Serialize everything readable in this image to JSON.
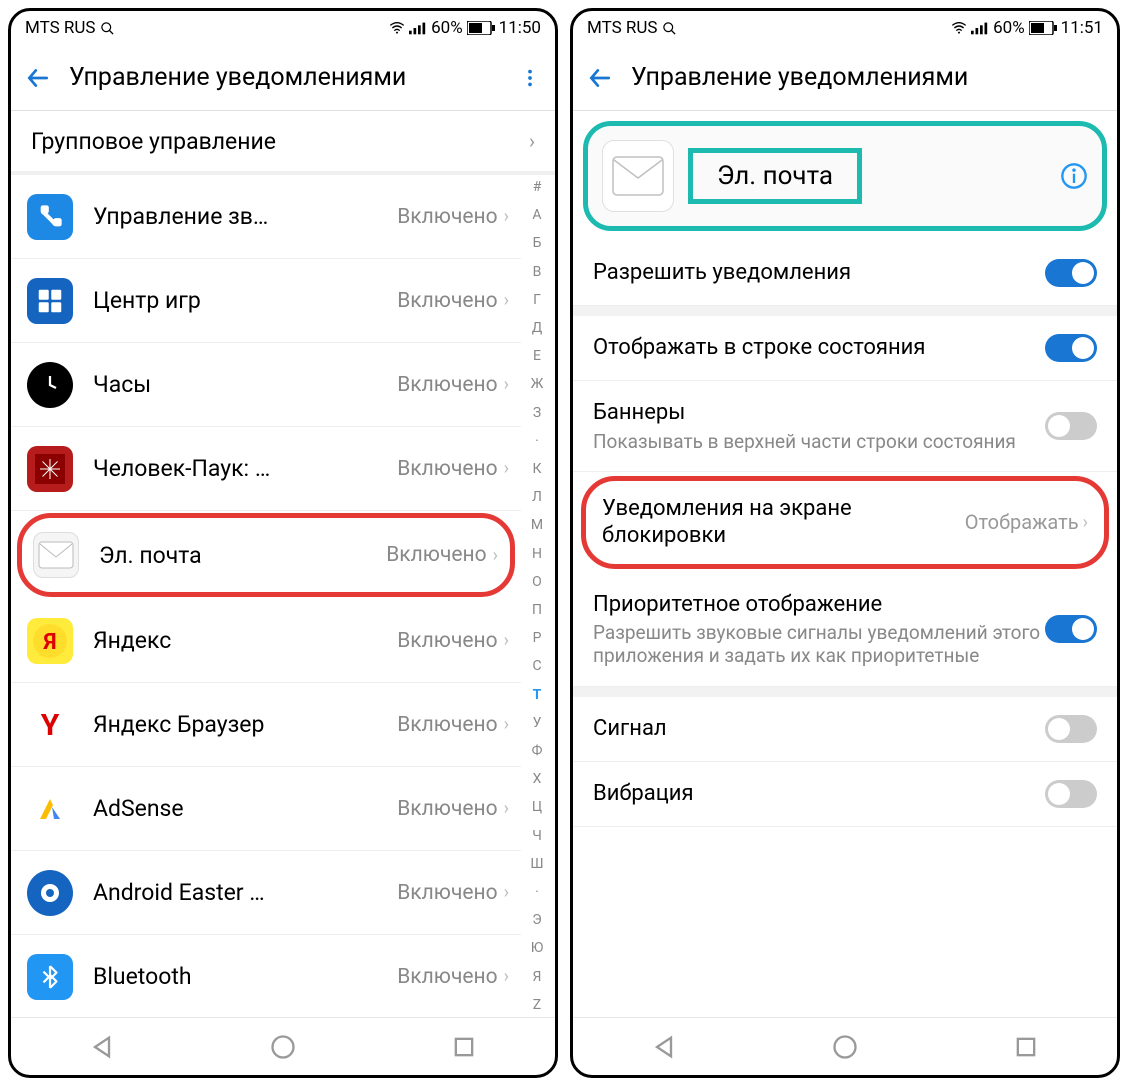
{
  "left": {
    "status": {
      "carrier": "MTS RUS",
      "battery": "60%",
      "time": "11:50"
    },
    "header": {
      "title": "Управление уведомлениями"
    },
    "group_row": "Групповое управление",
    "apps": [
      {
        "name": "Управление зв…",
        "status": "Включено",
        "icon": "phone",
        "hl": false
      },
      {
        "name": "Центр игр",
        "status": "Включено",
        "icon": "game",
        "hl": false
      },
      {
        "name": "Часы",
        "status": "Включено",
        "icon": "clock",
        "hl": false
      },
      {
        "name": "Человек-Паук: …",
        "status": "Включено",
        "icon": "spider",
        "hl": false
      },
      {
        "name": "Эл. почта",
        "status": "Включено",
        "icon": "mail",
        "hl": true
      },
      {
        "name": "Яндекс",
        "status": "Включено",
        "icon": "yandex",
        "hl": false
      },
      {
        "name": "Яндекс Браузер",
        "status": "Включено",
        "icon": "ybrowser",
        "hl": false
      },
      {
        "name": "AdSense",
        "status": "Включено",
        "icon": "adsense",
        "hl": false
      },
      {
        "name": "Android Easter …",
        "status": "Включено",
        "icon": "android",
        "hl": false
      },
      {
        "name": "Bluetooth",
        "status": "Включено",
        "icon": "bt",
        "hl": false
      }
    ],
    "index": [
      "#",
      "А",
      "Б",
      "В",
      "Г",
      "Д",
      "Е",
      "Ж",
      "З",
      "·",
      "К",
      "Л",
      "М",
      "Н",
      "О",
      "П",
      "Р",
      "С",
      "Т",
      "У",
      "Ф",
      "Х",
      "Ц",
      "Ч",
      "Ш",
      "·",
      "Э",
      "Ю",
      "Я",
      "Z"
    ],
    "index_active": "Т"
  },
  "right": {
    "status": {
      "carrier": "MTS RUS",
      "battery": "60%",
      "time": "11:51"
    },
    "header": {
      "title": "Управление уведомлениями"
    },
    "app_card": {
      "name": "Эл. почта"
    },
    "settings": [
      {
        "title": "Разрешить уведомления",
        "toggle": "on"
      },
      {
        "title": "Отображать в строке состояния",
        "toggle": "on",
        "spacer": true
      },
      {
        "title": "Баннеры",
        "sub": "Показывать в верхней части строки состояния",
        "toggle": "off"
      },
      {
        "title": "Уведомления на экране блокировки",
        "value": "Отображать",
        "hl": true
      },
      {
        "title": "Приоритетное отображение",
        "sub": "Разрешить звуковые сигналы уведомлений этого приложения и задать их как приоритетные",
        "toggle": "on"
      },
      {
        "title": "Сигнал",
        "toggle": "off",
        "spacer": true
      },
      {
        "title": "Вибрация",
        "toggle": "off"
      }
    ]
  }
}
